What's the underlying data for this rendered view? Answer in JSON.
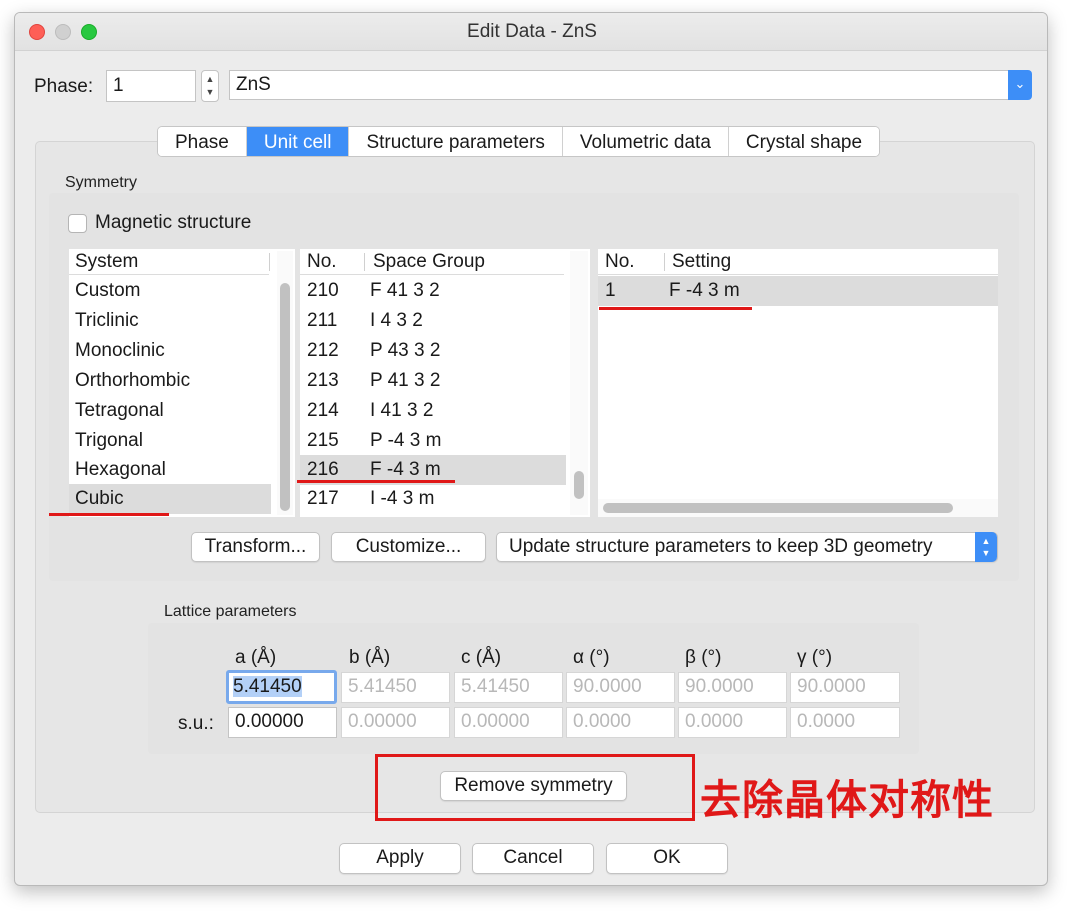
{
  "window": {
    "title": "Edit Data - ZnS"
  },
  "phase": {
    "label": "Phase:",
    "number": "1",
    "name": "ZnS"
  },
  "tabs": [
    {
      "label": "Phase"
    },
    {
      "label": "Unit cell"
    },
    {
      "label": "Structure parameters"
    },
    {
      "label": "Volumetric data"
    },
    {
      "label": "Crystal shape"
    }
  ],
  "symmetry": {
    "title": "Symmetry",
    "magnetic_label": "Magnetic structure",
    "system_header": "System",
    "systems": [
      "Custom",
      "Triclinic",
      "Monoclinic",
      "Orthorhombic",
      "Tetragonal",
      "Trigonal",
      "Hexagonal",
      "Cubic"
    ],
    "selected_system": "Cubic",
    "sg_headers": {
      "no": "No.",
      "name": "Space Group"
    },
    "space_groups": [
      {
        "no": "210",
        "name": "F 41 3 2"
      },
      {
        "no": "211",
        "name": "I 4 3 2"
      },
      {
        "no": "212",
        "name": "P 43 3 2"
      },
      {
        "no": "213",
        "name": "P 41 3 2"
      },
      {
        "no": "214",
        "name": "I 41 3 2"
      },
      {
        "no": "215",
        "name": "P -4 3 m"
      },
      {
        "no": "216",
        "name": "F -4 3 m"
      },
      {
        "no": "217",
        "name": "I -4 3 m"
      }
    ],
    "selected_space_group": "216",
    "setting_headers": {
      "no": "No.",
      "setting": "Setting"
    },
    "settings": [
      {
        "no": "1",
        "setting": "F -4 3 m"
      }
    ],
    "transform_button": "Transform...",
    "customize_button": "Customize...",
    "update_option": "Update structure parameters to keep 3D geometry"
  },
  "lattice": {
    "title": "Lattice parameters",
    "headers": [
      "a (Å)",
      "b (Å)",
      "c (Å)",
      "α (°)",
      "β (°)",
      "γ (°)"
    ],
    "values": [
      "5.41450",
      "5.41450",
      "5.41450",
      "90.0000",
      "90.0000",
      "90.0000"
    ],
    "su_label": "s.u.:",
    "su_values": [
      "0.00000",
      "0.00000",
      "0.00000",
      "0.0000",
      "0.0000",
      "0.0000"
    ]
  },
  "remove_symmetry_button": "Remove symmetry",
  "annotation": "去除晶体对称性",
  "buttons": {
    "apply": "Apply",
    "cancel": "Cancel",
    "ok": "OK"
  },
  "colors": {
    "accent": "#3d8ef7",
    "annotation_red": "#e01818"
  }
}
